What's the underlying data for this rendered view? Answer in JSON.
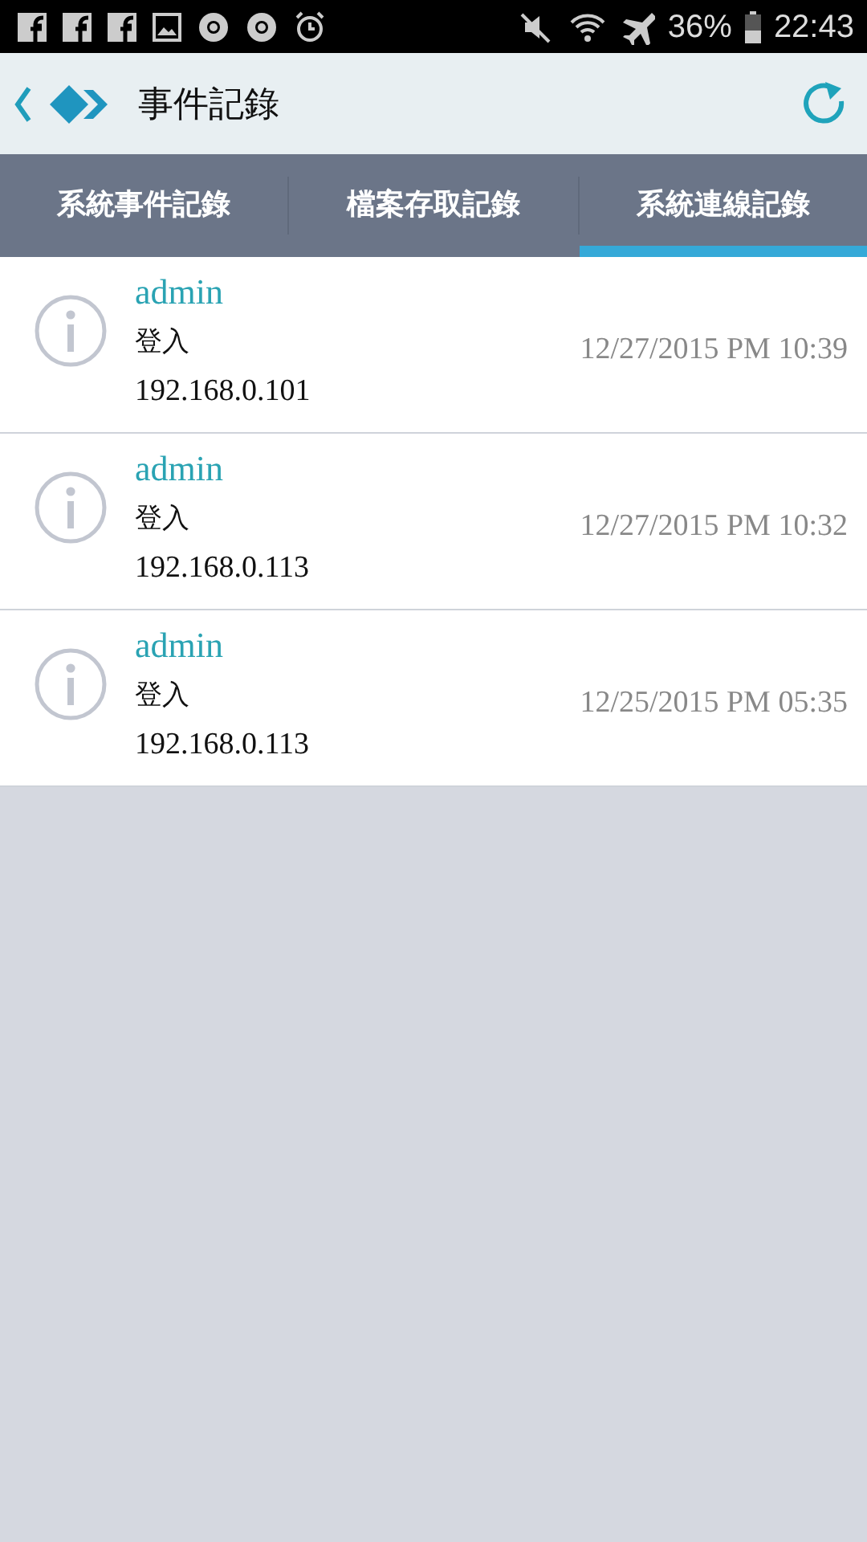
{
  "status_bar": {
    "battery": "36%",
    "time": "22:43"
  },
  "header": {
    "title": "事件記錄"
  },
  "tabs": [
    {
      "label": "系統事件記錄",
      "selected": false
    },
    {
      "label": "檔案存取記錄",
      "selected": false
    },
    {
      "label": "系統連線記錄",
      "selected": true
    }
  ],
  "entries": [
    {
      "user": "admin",
      "action": "登入",
      "ip": "192.168.0.101",
      "datetime": "12/27/2015 PM 10:39"
    },
    {
      "user": "admin",
      "action": "登入",
      "ip": "192.168.0.113",
      "datetime": "12/27/2015 PM 10:32"
    },
    {
      "user": "admin",
      "action": "登入",
      "ip": "192.168.0.113",
      "datetime": "12/25/2015 PM 05:35"
    }
  ]
}
